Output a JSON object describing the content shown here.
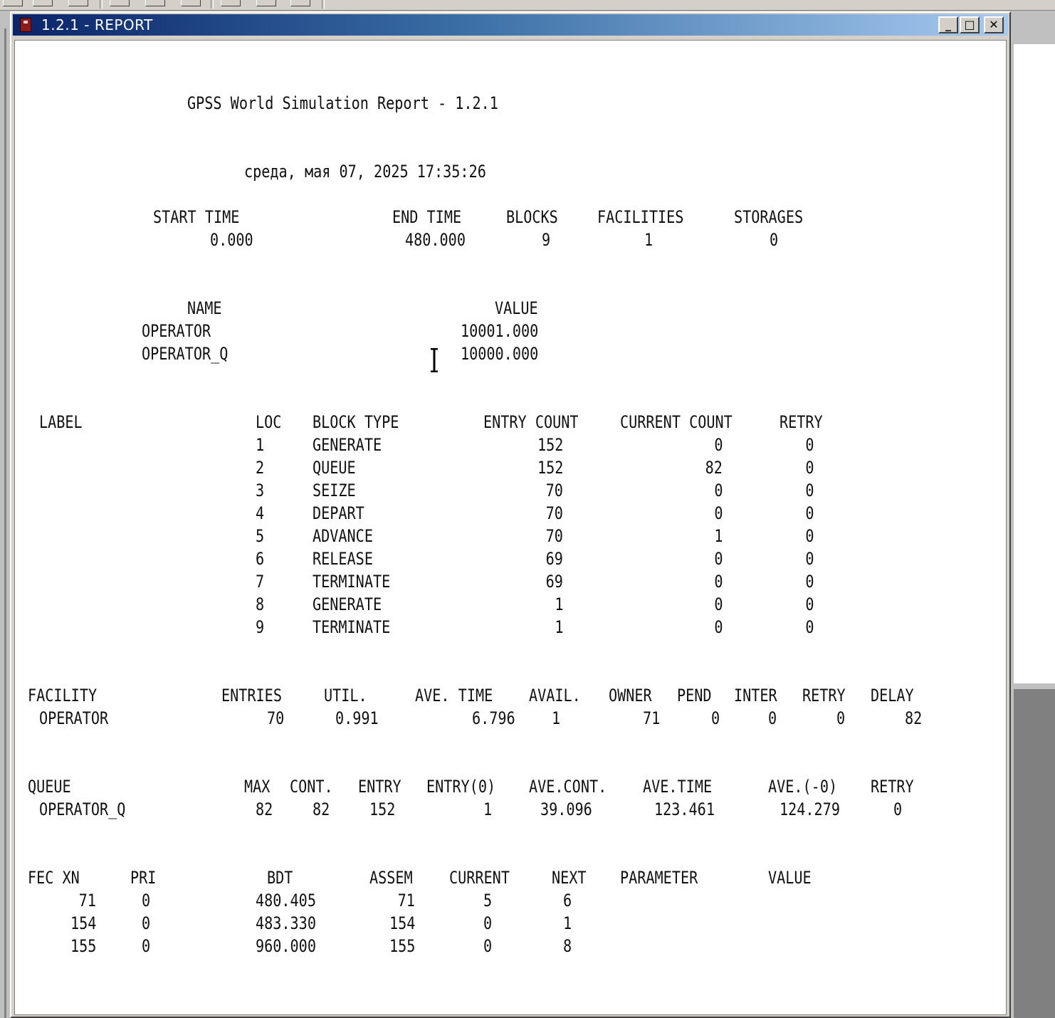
{
  "window": {
    "title": "1.2.1 - REPORT",
    "controls": {
      "minimize": "_",
      "maximize": "□",
      "close": "✕"
    }
  },
  "report": {
    "heading": "GPSS World Simulation Report - 1.2.1",
    "date_line": "среда, мая 07, 2025 17:35:26",
    "summary": {
      "headers": [
        "START TIME",
        "END TIME",
        "BLOCKS",
        "FACILITIES",
        "STORAGES"
      ],
      "values": [
        "0.000",
        "480.000",
        "9",
        "1",
        "0"
      ]
    },
    "names": {
      "headers": [
        "NAME",
        "VALUE"
      ],
      "rows": [
        [
          "OPERATOR",
          "10001.000"
        ],
        [
          "OPERATOR_Q",
          "10000.000"
        ]
      ]
    },
    "blocks": {
      "headers": [
        "LABEL",
        "LOC",
        "BLOCK TYPE",
        "ENTRY COUNT",
        "CURRENT COUNT",
        "RETRY"
      ],
      "rows": [
        [
          "1",
          "GENERATE",
          "152",
          "0",
          "0"
        ],
        [
          "2",
          "QUEUE",
          "152",
          "82",
          "0"
        ],
        [
          "3",
          "SEIZE",
          "70",
          "0",
          "0"
        ],
        [
          "4",
          "DEPART",
          "70",
          "0",
          "0"
        ],
        [
          "5",
          "ADVANCE",
          "70",
          "1",
          "0"
        ],
        [
          "6",
          "RELEASE",
          "69",
          "0",
          "0"
        ],
        [
          "7",
          "TERMINATE",
          "69",
          "0",
          "0"
        ],
        [
          "8",
          "GENERATE",
          "1",
          "0",
          "0"
        ],
        [
          "9",
          "TERMINATE",
          "1",
          "0",
          "0"
        ]
      ]
    },
    "facility": {
      "headers": [
        "FACILITY",
        "ENTRIES",
        "UTIL.",
        "AVE. TIME",
        "AVAIL.",
        "OWNER",
        "PEND",
        "INTER",
        "RETRY",
        "DELAY"
      ],
      "rows": [
        [
          "OPERATOR",
          "70",
          "0.991",
          "6.796",
          "1",
          "71",
          "0",
          "0",
          "0",
          "82"
        ]
      ]
    },
    "queue": {
      "headers": [
        "QUEUE",
        "MAX",
        "CONT.",
        "ENTRY",
        "ENTRY(0)",
        "AVE.CONT.",
        "AVE.TIME",
        "AVE.(-0)",
        "RETRY"
      ],
      "rows": [
        [
          "OPERATOR_Q",
          "82",
          "82",
          "152",
          "1",
          "39.096",
          "123.461",
          "124.279",
          "0"
        ]
      ]
    },
    "fec": {
      "headers": [
        "FEC XN",
        "PRI",
        "BDT",
        "ASSEM",
        "CURRENT",
        "NEXT",
        "PARAMETER",
        "VALUE"
      ],
      "rows": [
        [
          "71",
          "0",
          "480.405",
          "71",
          "5",
          "6"
        ],
        [
          "154",
          "0",
          "483.330",
          "154",
          "0",
          "1"
        ],
        [
          "155",
          "0",
          "960.000",
          "155",
          "0",
          "8"
        ]
      ]
    }
  }
}
